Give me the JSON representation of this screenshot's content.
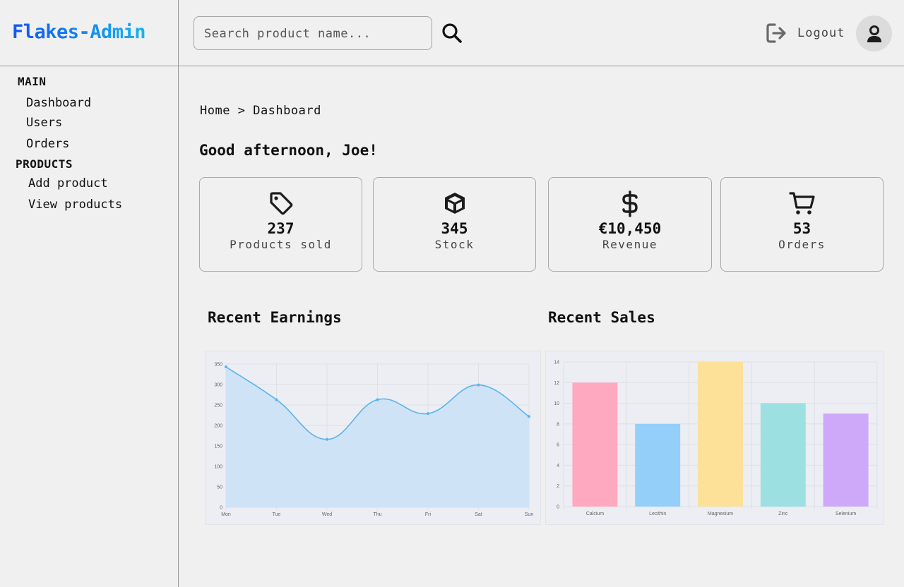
{
  "brand": "Flakes-Admin",
  "search": {
    "placeholder": "Search product name..."
  },
  "header": {
    "logout_label": "Logout"
  },
  "sidebar": {
    "sections": [
      {
        "title": "MAIN",
        "items": [
          "Dashboard",
          "Users",
          "Orders"
        ]
      },
      {
        "title": "PRODUCTS",
        "items": [
          "Add product",
          "View products"
        ]
      }
    ]
  },
  "breadcrumb": {
    "home": "Home",
    "separator": ">",
    "current": "Dashboard"
  },
  "greeting": "Good afternoon, Joe!",
  "stats": [
    {
      "icon": "tag-icon",
      "value": "237",
      "label": "Products sold"
    },
    {
      "icon": "box-icon",
      "value": "345",
      "label": "Stock"
    },
    {
      "icon": "dollar-icon",
      "value": "€10,450",
      "label": "Revenue"
    },
    {
      "icon": "cart-icon",
      "value": "53",
      "label": "Orders"
    }
  ],
  "charts": {
    "earnings_title": "Recent Earnings",
    "sales_title": "Recent Sales"
  },
  "chart_data": [
    {
      "type": "area",
      "categories": [
        "Mon",
        "Tue",
        "Wed",
        "Thu",
        "Fri",
        "Sat",
        "Sun"
      ],
      "values": [
        343,
        263,
        166,
        263,
        229,
        299,
        222
      ],
      "ylim": [
        0,
        350
      ],
      "yticks": [
        0,
        50,
        100,
        150,
        200,
        250,
        300,
        350
      ],
      "grid": true,
      "colors": {
        "line": "#5ab4ec",
        "fill": "#cde2f6"
      }
    },
    {
      "type": "bar",
      "categories": [
        "Calcium",
        "Lecithin",
        "Magnesium",
        "Zinc",
        "Selenium"
      ],
      "values": [
        12,
        8,
        14,
        10,
        9
      ],
      "ylim": [
        0,
        14
      ],
      "yticks": [
        0,
        2,
        4,
        6,
        8,
        10,
        12,
        14
      ],
      "grid": true,
      "colors": [
        "#ffa9c0",
        "#93cff9",
        "#fde199",
        "#9de0e2",
        "#cfa9f9"
      ]
    }
  ]
}
